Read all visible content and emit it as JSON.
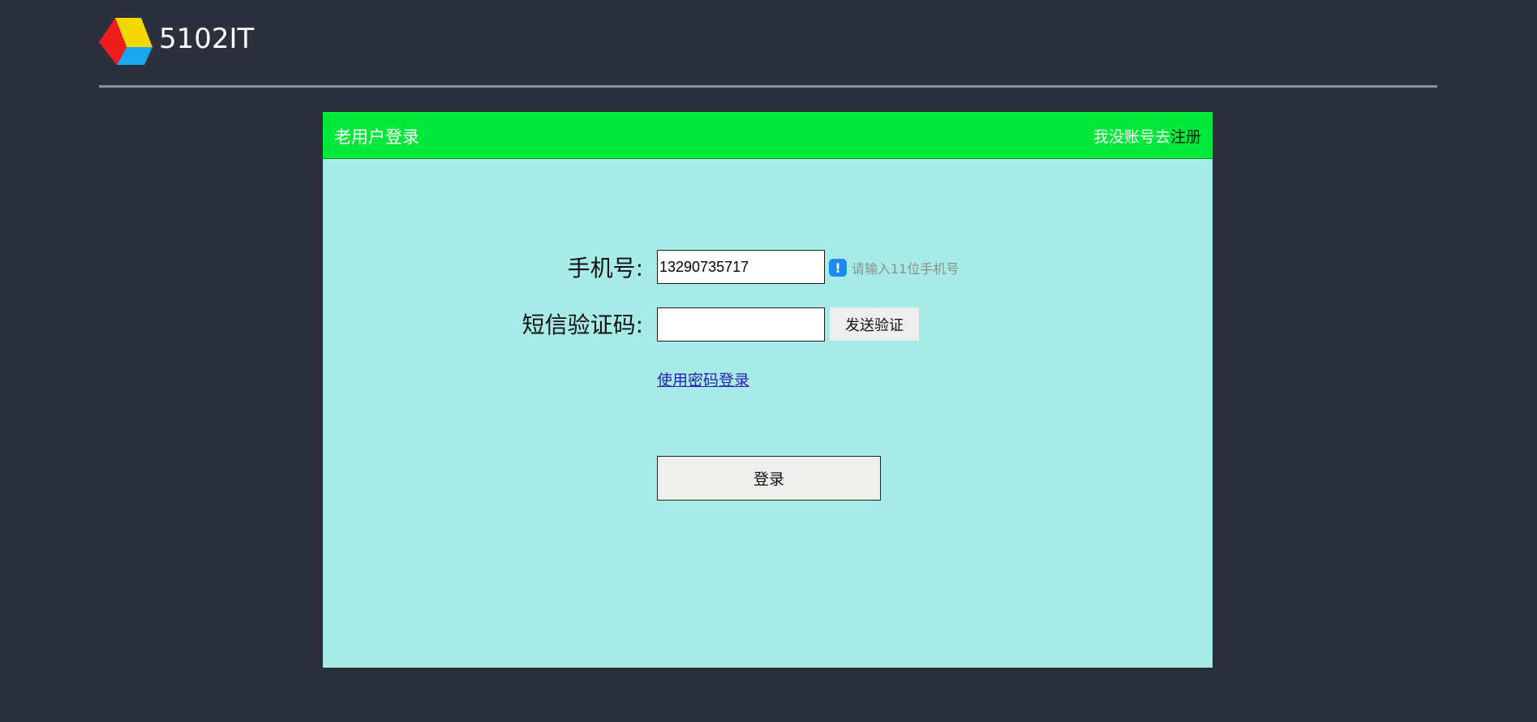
{
  "brand": {
    "name": "5102IT",
    "logo_icon": "tricolor-triangle-logo"
  },
  "card": {
    "title": "老用户登录",
    "register_prompt": "我没账号去",
    "register_link": "注册"
  },
  "form": {
    "phone_label": "手机号:",
    "phone_value": "13290735717",
    "phone_hint": "请输入11位手机号",
    "hint_icon": "info-exclamation-icon",
    "code_label": "短信验证码:",
    "code_value": "",
    "send_button": "发送验证",
    "password_login_link": "使用密码登录",
    "login_button": "登录"
  },
  "colors": {
    "background": "#2b303c",
    "card_header": "#00e83a",
    "card_body": "#a7ebe6",
    "hint_icon": "#1c8bf0",
    "link": "#2a1db8"
  }
}
